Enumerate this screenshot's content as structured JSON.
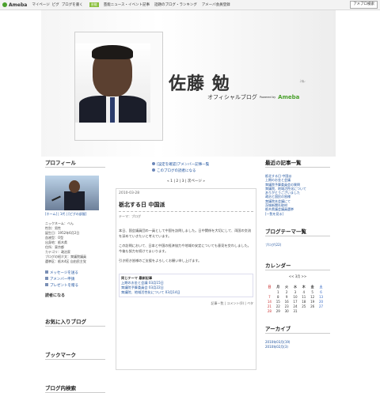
{
  "topbar": {
    "logo": "Ameba",
    "links": [
      "マイページ",
      "ピグ",
      "ブログを書く"
    ],
    "badge": "芸能",
    "news": "芸能ニュース・イベント記事",
    "featured": "話題のブログ・ランキング",
    "app": "アメーバ会員登録",
    "search_button": "アメブロ検索"
  },
  "header": {
    "name": "佐藤 勉",
    "subtitle": "オフィシャルブログ",
    "powered": "Powered by",
    "brand": "Ameba"
  },
  "left": {
    "profile_title": "プロフィール",
    "profile_links": "[ホーム] | 1代 | [ピグの部屋]",
    "profile_text": [
      "ニックネーム：べん",
      "性別：男性",
      "誕生日：1952年6月2日",
      "血液型：O型",
      "出身地：栃木県",
      "住所：東京都",
      "カテゴリ：政治家",
      "ブログの紹介文：衆議院議員",
      "選挙区：栃木4区 自由民主党"
    ],
    "buttons": [
      "メッセージを送る",
      "アメンバー申請",
      "プレゼントを贈る"
    ],
    "readers_label": "読者になる",
    "favorite_title": "お気に入りブログ",
    "bookmark_title": "ブックマーク",
    "search_title": "ブログ内検索"
  },
  "center": {
    "notices": [
      "[設定を確認]アメンバー記事一覧",
      "このブログの読者になる"
    ],
    "pager": "« 1 | 2 | 3 | 次ページ »",
    "post": {
      "date": "2010-03-28",
      "title": "栃北する日 中国派",
      "theme": "テーマ：ブログ",
      "body": [
        "本日、国会議員団の一員として中国を訪問しました。日中関係を大切にして、両国の交流を深めていきたいと考えています。",
        "この訪問において、日本と中国の経済協力や地域の安定についても意見を交わしました。今後も努力を続けてまいります。",
        "引き続き皆様のご支援をよろしくお願い申し上げます。"
      ],
      "related_title": "同じテーマ 最新記事",
      "related": [
        "上期のお金と会議 03月15日",
        "衆議院予算委員会 03月22日",
        "衆議院、地域活性化について 03月14日"
      ],
      "footer": "記事一覧 | コメント(0) | ペタ"
    }
  },
  "right": {
    "recent_title": "最近の記事一覧",
    "recent": [
      "栃北する日 中国派",
      "上期のお金と会議",
      "衆議院予算委員会の質問",
      "衆議院、地域活性化について",
      "ありがとうございました",
      "政治と国民の皆様",
      "衆議院本会議にて",
      "茨城新聞社取材",
      "栃木県議会議員選挙",
      "[一覧を見る]"
    ],
    "theme_title": "ブログテーマ一覧",
    "theme": [
      "ブログ(22)"
    ],
    "calendar_title": "カレンダー",
    "calendar_month": "<< 3月 >>",
    "weekdays": [
      "日",
      "月",
      "火",
      "水",
      "木",
      "金",
      "土"
    ],
    "weeks": [
      [
        "",
        "1",
        "2",
        "3",
        "4",
        "5",
        "6"
      ],
      [
        "7",
        "8",
        "9",
        "10",
        "11",
        "12",
        "13"
      ],
      [
        "14",
        "15",
        "16",
        "17",
        "18",
        "19",
        "20"
      ],
      [
        "21",
        "22",
        "23",
        "24",
        "25",
        "26",
        "27"
      ],
      [
        "28",
        "29",
        "30",
        "31",
        "",
        "",
        ""
      ]
    ],
    "archive_title": "アーカイブ",
    "archive": [
      "2010年03月(19)",
      "2010年02月(3)"
    ]
  }
}
